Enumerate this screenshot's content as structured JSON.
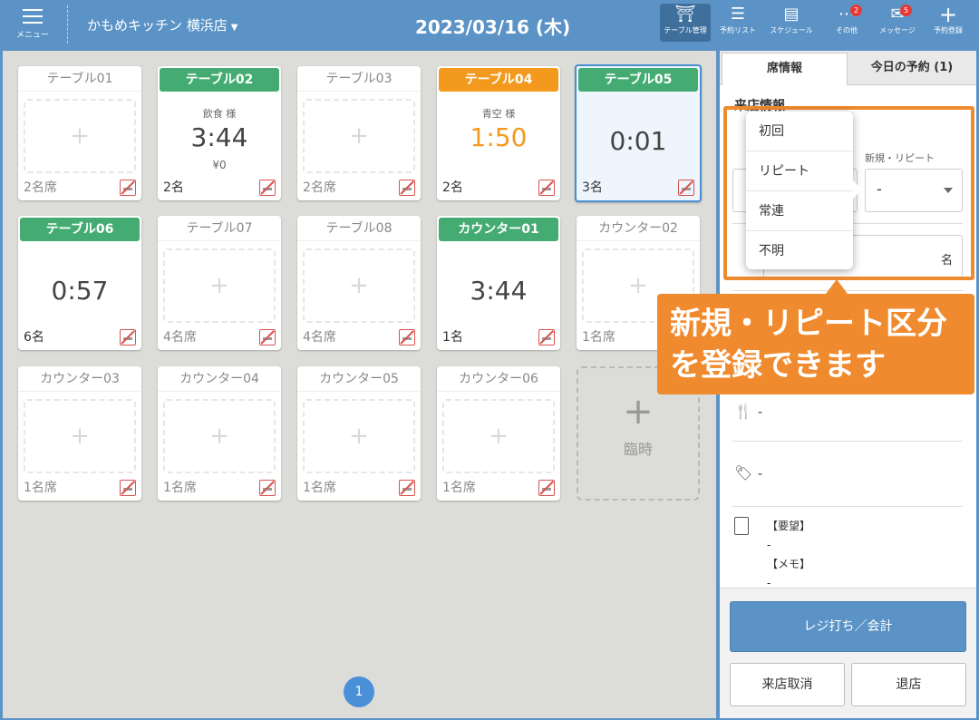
{
  "header": {
    "menu_label": "メニュー",
    "store_name": "かもめキッチン 横浜店",
    "date": "2023/03/16 (木)",
    "tools": [
      {
        "label": "テーブル管理",
        "icon": "table-icon"
      },
      {
        "label": "予約リスト",
        "icon": "list-icon"
      },
      {
        "label": "スケジュール",
        "icon": "schedule-icon"
      },
      {
        "label": "その他",
        "icon": "more-icon",
        "badge": "2"
      },
      {
        "label": "メッセージ",
        "icon": "mail-icon",
        "badge": "5"
      },
      {
        "label": "予約登録",
        "icon": "plus-icon"
      }
    ]
  },
  "tables": [
    {
      "name": "テーブル01",
      "seats": "2名席"
    },
    {
      "name": "テーブル02",
      "guest": "飲食 様",
      "time": "3:44",
      "amount": "¥0",
      "seats": "2名"
    },
    {
      "name": "テーブル03",
      "seats": "2名席"
    },
    {
      "name": "テーブル04",
      "guest": "青空 様",
      "time": "1:50",
      "seats": "2名"
    },
    {
      "name": "テーブル05",
      "time": "0:01",
      "seats": "3名"
    },
    {
      "name": "テーブル06",
      "time": "0:57",
      "seats": "6名"
    },
    {
      "name": "テーブル07",
      "seats": "4名席"
    },
    {
      "name": "テーブル08",
      "seats": "4名席"
    },
    {
      "name": "カウンター01",
      "time": "3:44",
      "seats": "1名"
    },
    {
      "name": "カウンター02",
      "seats": "1名席"
    },
    {
      "name": "カウンター03",
      "seats": "1名席"
    },
    {
      "name": "カウンター04",
      "seats": "1名席"
    },
    {
      "name": "カウンター05",
      "seats": "1名席"
    },
    {
      "name": "カウンター06",
      "seats": "1名席"
    }
  ],
  "temp_label": "臨時",
  "temp_plus": "+",
  "empty_plus": "+",
  "page_number": "1",
  "panel": {
    "tabs": [
      "席情報",
      "今日の予約 (1)"
    ],
    "section_title": "来店情報",
    "repeat_label": "新規・リピート",
    "repeat_value": "-",
    "count_unit": "名",
    "course_value": "-",
    "tag_value": "-",
    "request_label": "【要望】",
    "request_value": "-",
    "memo_label": "【メモ】",
    "memo_value": "-",
    "checkout_button": "レジ打ち／会計",
    "cancel_button": "来店取消",
    "leave_button": "退店"
  },
  "dropdown_options": [
    "初回",
    "リピート",
    "常連",
    "不明"
  ],
  "callout_text_line1": "新規・リピート区分",
  "callout_text_line2": "を登録できます",
  "colors": {
    "header": "#5b93c6",
    "occupied": "#44ac73",
    "reserved": "#f39a1e",
    "highlight": "#f08a2e"
  }
}
